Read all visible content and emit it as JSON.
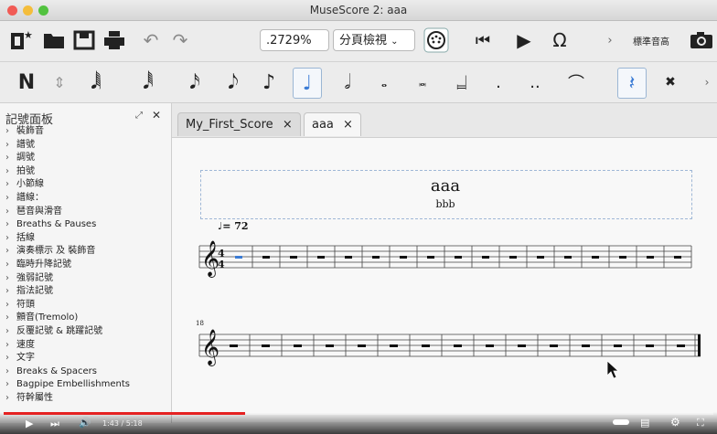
{
  "window": {
    "title": "MuseScore 2: aaa"
  },
  "toolbar": {
    "zoom": ".2729%",
    "view_mode": "分頁檢視",
    "concert_pitch": "標準音高",
    "more": "›"
  },
  "palette": {
    "title": "記號面板",
    "items": [
      "裝飾音",
      "譜號",
      "調號",
      "拍號",
      "小節線",
      "譜線：",
      "琶音與滑音",
      "Breaths & Pauses",
      "括線",
      "演奏標示 及 裝飾音",
      "臨時升降記號",
      "強弱記號",
      "指法記號",
      "符頭",
      "顫音(Tremolo)",
      "反覆記號 & 跳躍記號",
      "速度",
      "文字",
      "Breaks & Spacers",
      "Bagpipe Embellishments",
      "符幹屬性"
    ]
  },
  "tabs": [
    {
      "label": "My_First_Score",
      "close": "×"
    },
    {
      "label": "aaa",
      "close": "×"
    }
  ],
  "score": {
    "title": "aaa",
    "subtitle": "bbb",
    "tempo": "♩= 72",
    "system2_measure_number": "18"
  },
  "video": {
    "time": "1:43 / 5:18",
    "progress": 0.34
  }
}
